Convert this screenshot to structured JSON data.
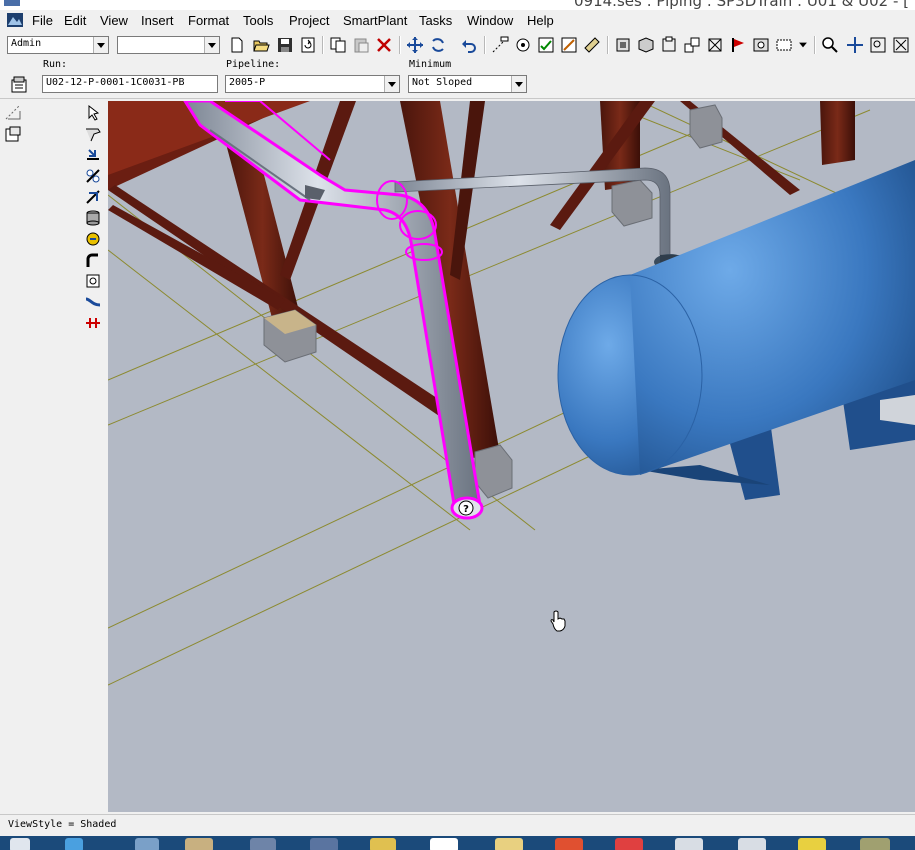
{
  "window": {
    "title": "0914.ses : Piping : SP3DTrain : U01 & U02 - ["
  },
  "menu": [
    "File",
    "Edit",
    "View",
    "Insert",
    "Format",
    "Tools",
    "Project",
    "SmartPlant",
    "Tasks",
    "Window",
    "Help"
  ],
  "toolbar": {
    "permission_group": "Admin",
    "filter_value": "",
    "buttons": [
      "new-icon",
      "open-icon",
      "save-icon",
      "refresh-icon",
      "copy-icon",
      "paste-icon",
      "delete-icon",
      "move-icon",
      "rotate-icon",
      "undo-icon",
      "measure-icon",
      "inspect-icon",
      "check-icon",
      "sketch-icon",
      "ruler-icon",
      "select-set-icon",
      "view-icon",
      "clip-icon",
      "layer-icon",
      "fit-icon",
      "flag-icon",
      "snapshot-icon",
      "options-icon",
      "zoom-icon",
      "pan-icon",
      "zoom-area-icon",
      "zoom-fit-icon"
    ]
  },
  "ribbon": {
    "run_label": "Run:",
    "run_value": "U02-12-P-0001-1C0031-PB",
    "pipeline_label": "Pipeline:",
    "pipeline_value": "2005-P",
    "minimum_label": "Minimum",
    "minimum_value": "Not Sloped"
  },
  "left_pane": {
    "icons": [
      "properties-icon",
      "hierarchy-icon"
    ]
  },
  "vertical_toolbar": {
    "tools": [
      "select-tool-icon",
      "route-pipe-icon",
      "insert-component-icon",
      "connect-icon",
      "insert-split-icon",
      "insert-tap-icon",
      "place-spec-icon",
      "route-bend-icon",
      "insert-support-icon",
      "route-slope-icon",
      "insert-flange-icon"
    ]
  },
  "viewport": {
    "style": "Shaded",
    "pipe_highlight_color": "#ff00ff",
    "vessel_color": "#3a78c0",
    "structure_color": "#6b1e12",
    "floor_color": "#b3b9c5"
  },
  "status": {
    "text": "ViewStyle = Shaded"
  }
}
